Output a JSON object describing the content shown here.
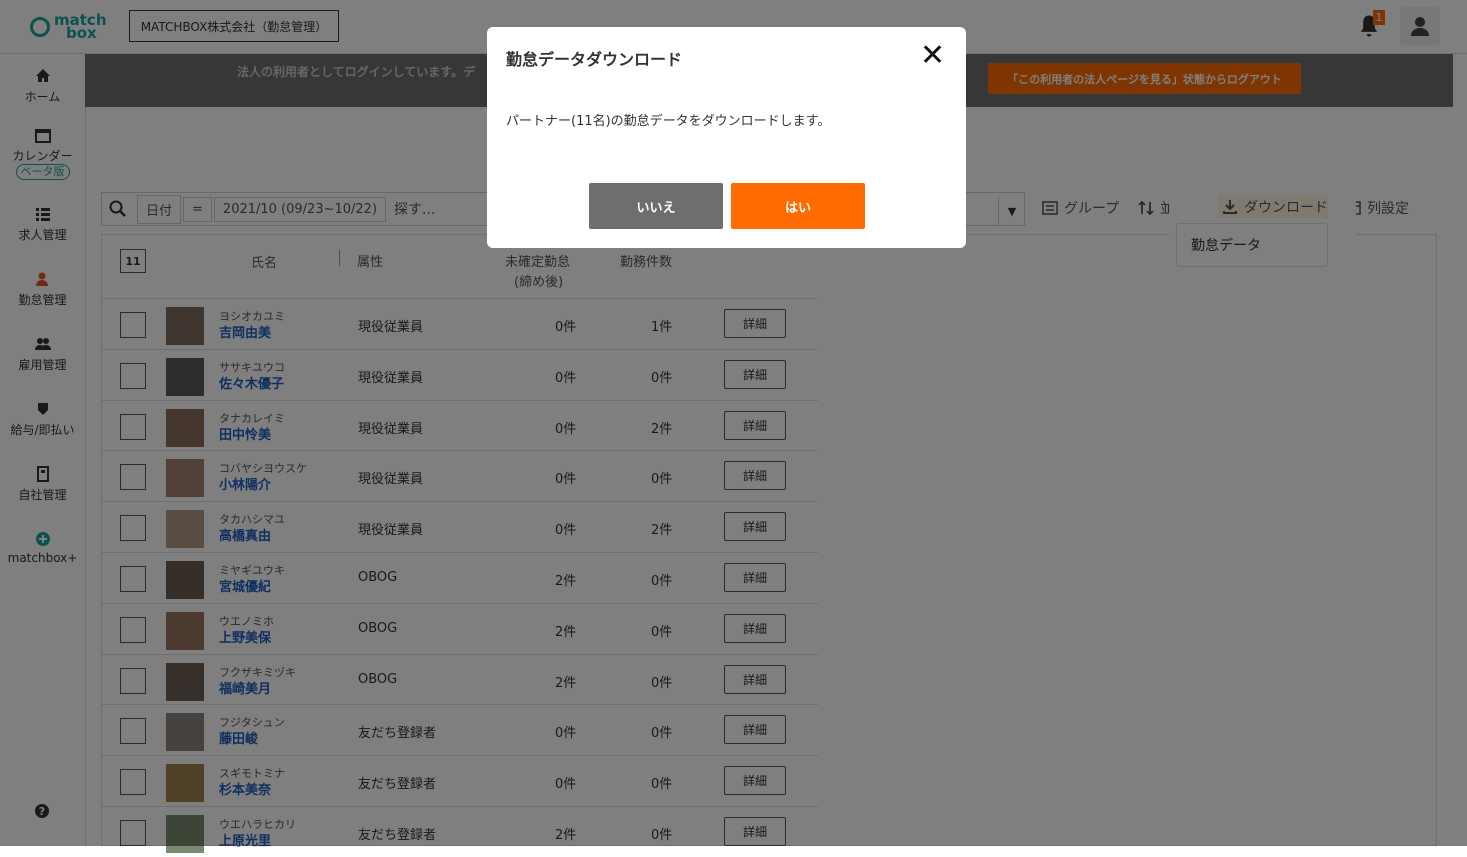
{
  "header": {
    "logo_text_1": "match",
    "logo_text_2": "box",
    "company": "MATCHBOX株式会社（勤怠管理）",
    "notification_count": "1"
  },
  "sidebar": {
    "items": [
      {
        "label": "ホーム",
        "icon": "home-icon"
      },
      {
        "label": "カレンダー",
        "icon": "calendar-icon",
        "badge": "ベータ版"
      },
      {
        "label": "求人管理",
        "icon": "list-icon"
      },
      {
        "label": "勤怠管理",
        "icon": "attendance-icon"
      },
      {
        "label": "雇用管理",
        "icon": "people-icon"
      },
      {
        "label": "給与/即払い",
        "icon": "payment-icon"
      },
      {
        "label": "自社管理",
        "icon": "company-icon"
      },
      {
        "label": "matchbox+",
        "icon": "plus-icon"
      }
    ],
    "help_icon": "help-icon"
  },
  "banner": {
    "text": "法人の利用者としてログインしています。デ",
    "logout_label": "「この利用者の法人ページを見る」状態からログアウト"
  },
  "search": {
    "date_tag": "日付",
    "eq_tag": "=",
    "period_tag": "2021/10 (09/23~10/22)",
    "placeholder": "探す..."
  },
  "toolbar": {
    "group": "グループ",
    "sort": "並替え",
    "download": "ダウンロード",
    "columns": "列設定",
    "download_menu_item": "勤怠データ"
  },
  "table": {
    "count": "11",
    "headers": {
      "name": "氏名",
      "attr": "属性",
      "pending": "未確定勤怠",
      "pending_sub": "(締め後)",
      "work_count": "勤務件数"
    },
    "detail_label": "詳細",
    "rows": [
      {
        "kana": "ヨシオカユミ",
        "name": "吉岡由美",
        "attr": "現役従業員",
        "pending": "0件",
        "count": "1件"
      },
      {
        "kana": "ササキユウコ",
        "name": "佐々木優子",
        "attr": "現役従業員",
        "pending": "0件",
        "count": "0件"
      },
      {
        "kana": "タナカレイミ",
        "name": "田中怜美",
        "attr": "現役従業員",
        "pending": "0件",
        "count": "2件"
      },
      {
        "kana": "コバヤシヨウスケ",
        "name": "小林陽介",
        "attr": "現役従業員",
        "pending": "0件",
        "count": "0件"
      },
      {
        "kana": "タカハシマユ",
        "name": "高橋真由",
        "attr": "現役従業員",
        "pending": "0件",
        "count": "2件"
      },
      {
        "kana": "ミヤギユウキ",
        "name": "宮城優紀",
        "attr": "OBOG",
        "pending": "2件",
        "count": "0件"
      },
      {
        "kana": "ウエノミホ",
        "name": "上野美保",
        "attr": "OBOG",
        "pending": "2件",
        "count": "0件"
      },
      {
        "kana": "フクザキミヅキ",
        "name": "福崎美月",
        "attr": "OBOG",
        "pending": "2件",
        "count": "0件"
      },
      {
        "kana": "フジタシュン",
        "name": "藤田峻",
        "attr": "友だち登録者",
        "pending": "0件",
        "count": "0件"
      },
      {
        "kana": "スギモトミナ",
        "name": "杉本美奈",
        "attr": "友だち登録者",
        "pending": "0件",
        "count": "0件"
      },
      {
        "kana": "ウエハラヒカリ",
        "name": "上原光里",
        "attr": "友だち登録者",
        "pending": "2件",
        "count": "0件"
      }
    ]
  },
  "modal": {
    "title": "勤怠データダウンロード",
    "body": "パートナー(11名)の勤怠データをダウンロードします。",
    "no_label": "いいえ",
    "yes_label": "はい"
  },
  "colors": {
    "accent": "#ff6b00",
    "brand": "#1aa59a",
    "link": "#1f5fbf"
  }
}
